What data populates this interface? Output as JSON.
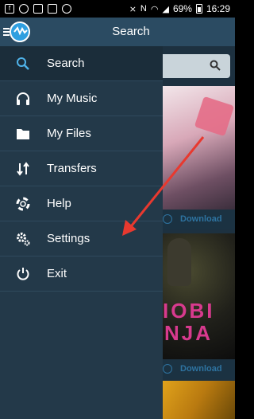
{
  "status_bar": {
    "battery": "69%",
    "time": "16:29"
  },
  "app_bar": {
    "title": "Search"
  },
  "drawer": {
    "items": [
      {
        "label": "Search",
        "icon": "search-icon",
        "active": true
      },
      {
        "label": "My Music",
        "icon": "headphones-icon"
      },
      {
        "label": "My Files",
        "icon": "folder-icon"
      },
      {
        "label": "Transfers",
        "icon": "transfer-arrows-icon"
      },
      {
        "label": "Help",
        "icon": "lifebuoy-icon"
      },
      {
        "label": "Settings",
        "icon": "gears-icon"
      },
      {
        "label": "Exit",
        "icon": "power-icon"
      }
    ]
  },
  "content": {
    "results": [
      {
        "download_label": "Download"
      },
      {
        "download_label": "Download"
      }
    ],
    "album_art_text": [
      "IOBI",
      "NJA"
    ]
  },
  "colors": {
    "drawer_bg": "#233949",
    "app_bar_bg": "#2b4b62",
    "accent": "#2e73a0",
    "annotation_arrow": "#e8392f"
  }
}
